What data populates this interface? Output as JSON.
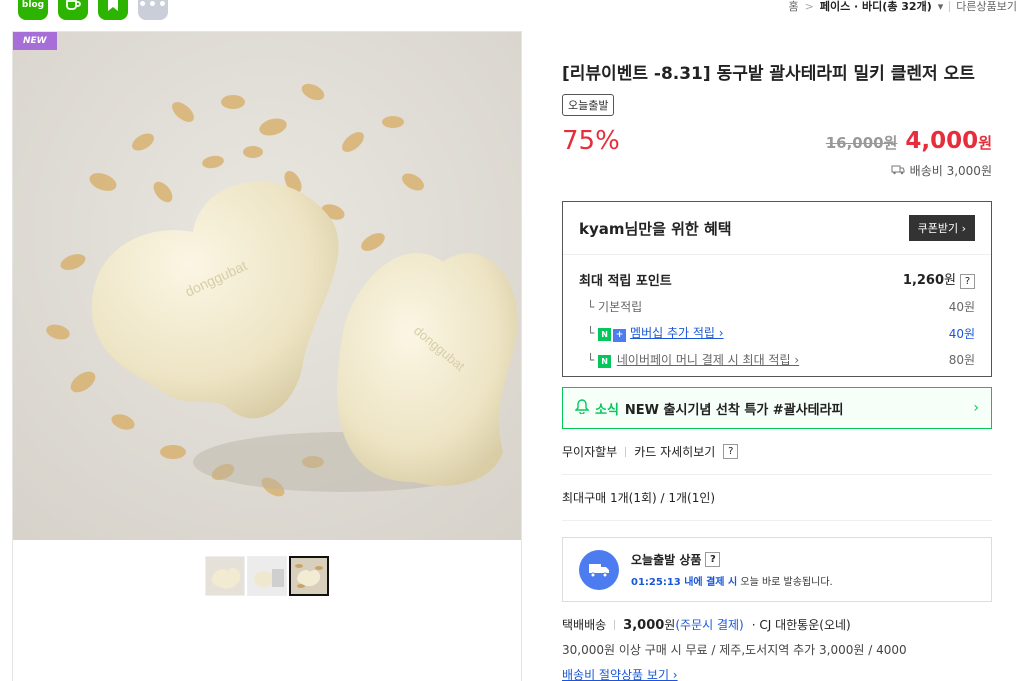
{
  "share": {
    "blog_label": "blog",
    "more_label": "•••"
  },
  "breadcrumb": {
    "home": "홈",
    "sep": ">",
    "category": "페이스 · 바디(총 32개)",
    "other": "다른상품보기"
  },
  "image": {
    "badge": "NEW"
  },
  "product": {
    "title": "[리뷰이벤트 -8.31] 동구밭 괄사테라피 밀키 클렌저 오트",
    "tag": "오늘출발",
    "discount": "75%",
    "original_price": "16,000원",
    "sale_price": "4,000",
    "sale_unit": "원",
    "shipping_fee": "배송비 3,000원"
  },
  "benefit": {
    "title": "kyam님만을 위한 혜택",
    "coupon_button": "쿠폰받기 ›",
    "max_points_label": "최대 적립 포인트",
    "max_points_value": "1,260",
    "max_points_unit": "원",
    "basic_label": "기본적립",
    "basic_value": "40원",
    "membership_label": "멤버십 추가 적립 ›",
    "membership_value": "40원",
    "npay_label": "네이버페이 머니 결제 시 최대 적립 ›",
    "npay_value": "80원",
    "question": "?"
  },
  "news": {
    "label": "소식",
    "text": "NEW 출시기념 선착 특가 #괄사테라피",
    "arrow": "›"
  },
  "payment": {
    "installment": "무이자할부",
    "card": "카드 자세히보기",
    "question": "?"
  },
  "limit": {
    "text": "최대구매 1개(1회) / 1개(1인)"
  },
  "today_ship": {
    "title": "오늘출발 상품",
    "question": "?",
    "time": "01:25:13 내에 결제 시",
    "desc": " 오늘 바로 발송됩니다."
  },
  "delivery": {
    "type": "택배배송",
    "fee": "3,000",
    "fee_unit": "원",
    "fee_note": "(주문시 결제)",
    "carrier": "· CJ 대한통운(오네)",
    "free_note": "30,000원 이상 구매 시 무료 / 제주,도서지역 추가 3,000원 / 4000",
    "saving_link": "배송비 절약상품 보기 ›"
  },
  "colors": {
    "accent_red": "#e52d3c",
    "naver_green": "#03c75a",
    "link_blue": "#1a57d6"
  }
}
